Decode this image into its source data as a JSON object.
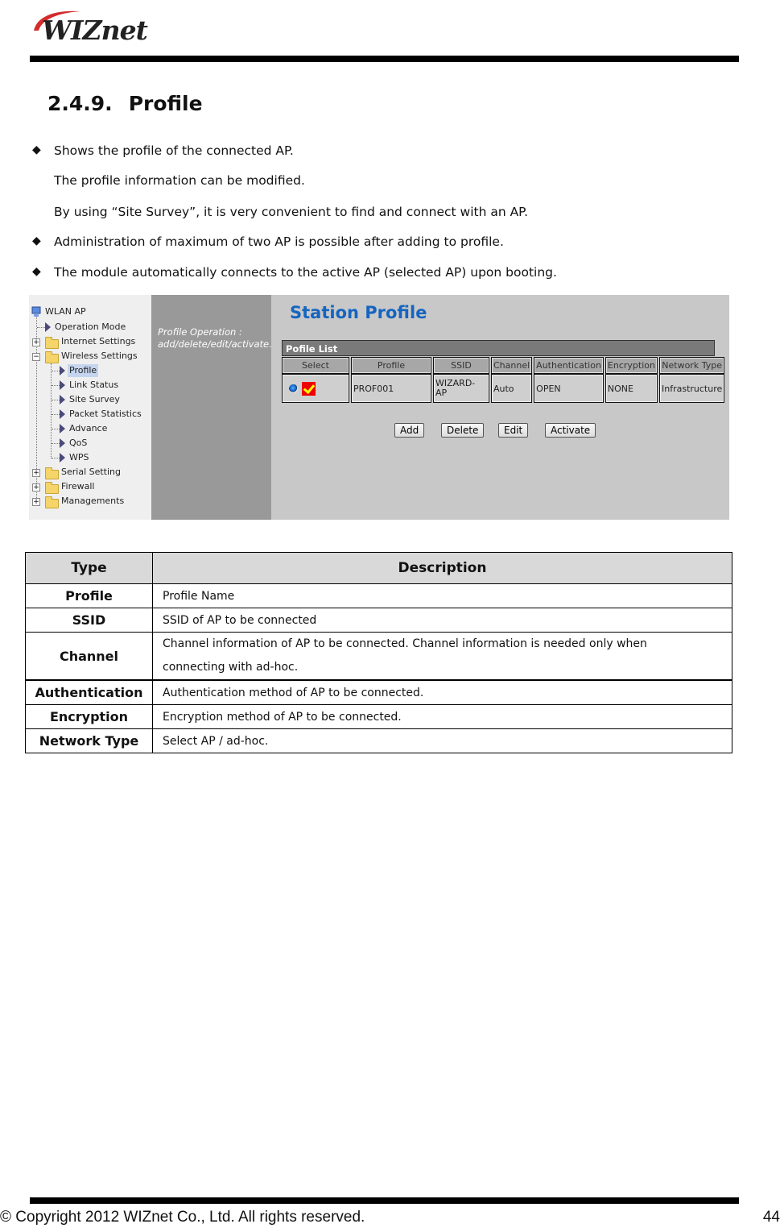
{
  "header": {
    "logo_text": "WIZnet",
    "brand_color": "#d42b2b"
  },
  "section": {
    "number": "2.4.9.",
    "title": "Profile"
  },
  "bullets": [
    {
      "marker": "◆",
      "text": "Shows the profile of the connected AP."
    },
    {
      "marker": "",
      "text": "The profile information can be modified."
    },
    {
      "marker": "",
      "text": "By using “Site Survey”, it is very convenient to find and connect with an AP."
    },
    {
      "marker": "◆",
      "text": "Administration of maximum of two AP is possible after adding to profile."
    },
    {
      "marker": "◆",
      "text": "The module automatically connects to the active AP (selected AP) upon booting."
    }
  ],
  "screenshot": {
    "tree": {
      "root": "WLAN AP",
      "items": [
        {
          "label": "Operation Mode",
          "type": "page"
        },
        {
          "label": "Internet Settings",
          "type": "folder",
          "expanded": false
        },
        {
          "label": "Wireless Settings",
          "type": "folder",
          "expanded": true
        },
        {
          "label": "Profile",
          "type": "page",
          "selected": true
        },
        {
          "label": "Link Status",
          "type": "page"
        },
        {
          "label": "Site Survey",
          "type": "page"
        },
        {
          "label": "Packet Statistics",
          "type": "page"
        },
        {
          "label": "Advance",
          "type": "page"
        },
        {
          "label": "QoS",
          "type": "page"
        },
        {
          "label": "WPS",
          "type": "page"
        },
        {
          "label": "Serial Setting",
          "type": "folder",
          "expanded": false
        },
        {
          "label": "Firewall",
          "type": "folder",
          "expanded": false
        },
        {
          "label": "Managements",
          "type": "folder",
          "expanded": false
        }
      ]
    },
    "hint": {
      "line1": "Profile Operation :",
      "line2": "add/delete/edit/activate."
    },
    "title": "Station Profile",
    "title_color": "#1565c0",
    "list_title": "Pofile List",
    "columns": [
      "Select",
      "Profile",
      "SSID",
      "Channel",
      "Authentication",
      "Encryption",
      "Network Type"
    ],
    "rows": [
      {
        "selected": true,
        "active": true,
        "profile": "PROF001",
        "ssid": "WIZARD-AP",
        "ssid_line1": "WIZARD-",
        "ssid_line2": "AP",
        "channel": "Auto",
        "authentication": "OPEN",
        "encryption": "NONE",
        "network_type": "Infrastructure"
      }
    ],
    "buttons": {
      "add": "Add",
      "delete": "Delete",
      "edit": "Edit",
      "activate": "Activate"
    }
  },
  "description_table": {
    "headers": [
      "Type",
      "Description"
    ],
    "rows": [
      {
        "type": "Profile",
        "description": "Profile Name"
      },
      {
        "type": "SSID",
        "description": "SSID of AP to be connected"
      },
      {
        "type": "Channel",
        "description_line1": "Channel information of AP to be connected. Channel information is needed only when",
        "description_line2": "connecting with ad-hoc."
      },
      {
        "type": "Authentication",
        "description": "Authentication method of AP to be connected."
      },
      {
        "type": "Encryption",
        "description": "Encryption method of AP to be connected."
      },
      {
        "type": "Network Type",
        "description": "Select AP / ad-hoc."
      }
    ]
  },
  "footer": {
    "copyright": "© Copyright 2012 WIZnet Co., Ltd. All rights reserved.",
    "page_number": "44"
  }
}
